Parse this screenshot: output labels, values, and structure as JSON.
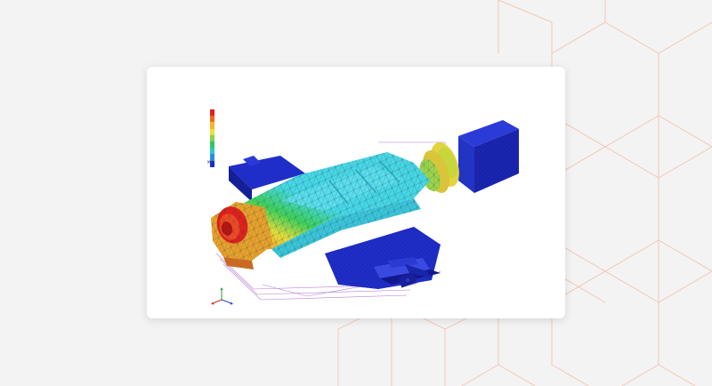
{
  "window": {
    "title": ""
  },
  "legend": {
    "header_lines": [
      "",
      "",
      "",
      "",
      "",
      ""
    ],
    "ticks": [
      "",
      "",
      "",
      "",
      "",
      "",
      "",
      "",
      ""
    ],
    "colors": [
      "#e3201c",
      "#f06a1a",
      "#f7b62a",
      "#e7e33a",
      "#8ad14a",
      "#34c46b",
      "#2cc9c9",
      "#2a8ce0",
      "#1f2ec8"
    ]
  },
  "icons": {
    "close": "close-icon",
    "axis": "axis-triad-icon"
  },
  "colors": {
    "page_background": "#f3f3f3",
    "card_background": "#ffffff",
    "hex_pattern": "#f4b9a4",
    "mesh_blue": "#1f2ec8",
    "mesh_cyan": "#46d8e6",
    "mesh_green": "#3ed25a",
    "mesh_yellow": "#ecd43a",
    "mesh_red": "#e3201c"
  }
}
